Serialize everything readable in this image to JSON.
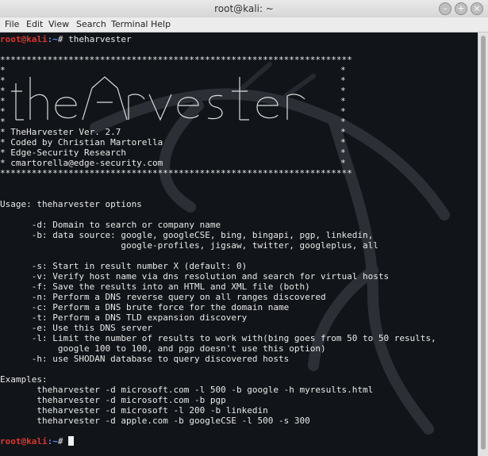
{
  "window": {
    "title": "root@kali: ~"
  },
  "menu": [
    "File",
    "Edit",
    "View",
    "Search",
    "Terminal",
    "Help"
  ],
  "prompt": {
    "user": "root@kali",
    "path": ":~",
    "symbol": "#",
    "command": " theharvester"
  },
  "banner": {
    "border": "*******************************************************************",
    "star": "*",
    "lines": [
      "* TheHarvester Ver. 2.7",
      "* Coded by Christian Martorella",
      "* Edge-Security Research",
      "* cmartorella@edge-security.com"
    ]
  },
  "usage": "Usage: theharvester options",
  "options": [
    "      -d: Domain to search or company name",
    "      -b: data source: google, googleCSE, bing, bingapi, pgp, linkedin,",
    "                       google-profiles, jigsaw, twitter, googleplus, all",
    "",
    "      -s: Start in result number X (default: 0)",
    "      -v: Verify host name via dns resolution and search for virtual hosts",
    "      -f: Save the results into an HTML and XML file (both)",
    "      -n: Perform a DNS reverse query on all ranges discovered",
    "      -c: Perform a DNS brute force for the domain name",
    "      -t: Perform a DNS TLD expansion discovery",
    "      -e: Use this DNS server",
    "      -l: Limit the number of results to work with(bing goes from 50 to 50 results,",
    "           google 100 to 100, and pgp doesn't use this option)",
    "      -h: use SHODAN database to query discovered hosts"
  ],
  "examples_label": "Examples:",
  "examples": [
    "       theharvester -d microsoft.com -l 500 -b google -h myresults.html",
    "       theharvester -d microsoft.com -b pgp",
    "       theharvester -d microsoft -l 200 -b linkedin",
    "       theharvester -d apple.com -b googleCSE -l 500 -s 300"
  ],
  "colors": {
    "prompt_user": "#e0352b",
    "prompt_path": "#5f8fff",
    "text": "#e9e9e9",
    "background": "#111418"
  }
}
